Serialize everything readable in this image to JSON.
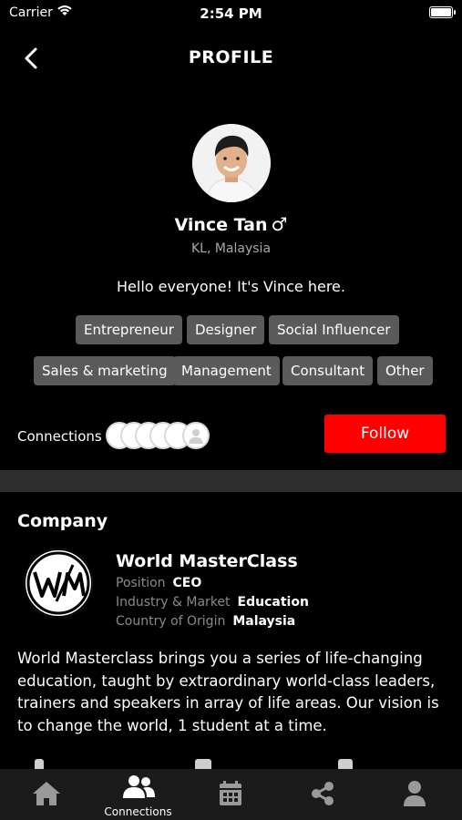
{
  "status": {
    "carrier": "Carrier",
    "time": "2:54 PM"
  },
  "nav": {
    "title": "PROFILE"
  },
  "profile": {
    "name": "Vince Tan",
    "gender_symbol": "♂",
    "location": "KL, Malaysia",
    "bio": "Hello everyone! It's Vince here.",
    "tags": [
      "Entrepreneur",
      "Designer",
      "Social Influencer",
      "Sales & marketing",
      "Management",
      "Consultant",
      "Other"
    ]
  },
  "connections": {
    "label": "Connections",
    "follow_label": "Follow"
  },
  "company": {
    "heading": "Company",
    "name": "World MasterClass",
    "rows": [
      {
        "label": "Position",
        "value": "CEO"
      },
      {
        "label": "Industry & Market",
        "value": "Education"
      },
      {
        "label": "Country of Origin",
        "value": "Malaysia"
      }
    ],
    "description": "World Masterclass brings you a series of life-changing education, taught by extraordinary world-class leaders, trainers and speakers in array of life areas. Our vision is to change the world, 1 student at a time."
  },
  "tabs": [
    {
      "icon": "home-icon",
      "label": ""
    },
    {
      "icon": "people-icon",
      "label": "Connections"
    },
    {
      "icon": "calendar-icon",
      "label": ""
    },
    {
      "icon": "share-icon",
      "label": ""
    },
    {
      "icon": "user-icon",
      "label": ""
    }
  ],
  "colors": {
    "accent": "#ff0000",
    "tag_bg": "#5a5a5a",
    "tab_bar": "#1b1b1b"
  }
}
